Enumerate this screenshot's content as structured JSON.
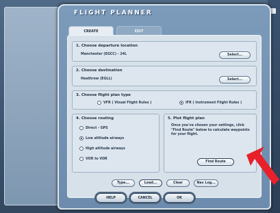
{
  "window": {
    "title": "FLIGHT PLANNER"
  },
  "tabs": [
    {
      "label": "CREATE"
    },
    {
      "label": "EDIT"
    }
  ],
  "section1": {
    "title": "1. Choose departure location",
    "value": "Manchester (EGCC) - 24L",
    "button": "Select..."
  },
  "section2": {
    "title": "2. Choose destination",
    "value": "Heathrow (EGLL)",
    "button": "Select..."
  },
  "section3": {
    "title": "3. Choose flight plan type",
    "options": [
      {
        "label": "VFR  ( Visual Flight Rules )",
        "selected": false
      },
      {
        "label": "IFR  ( Instrument Flight Rules )",
        "selected": true
      }
    ]
  },
  "section4": {
    "title": "4. Choose routing",
    "options": [
      {
        "label": "Direct - GPS",
        "selected": false
      },
      {
        "label": "Low altitude airways",
        "selected": true
      },
      {
        "label": "High altitude airways",
        "selected": false
      },
      {
        "label": "VOR to VOR",
        "selected": false
      }
    ]
  },
  "section5": {
    "title": "5. Plot flight plan",
    "text": "Once you've chosen your settings, click \"Find Route\" below to calculate waypoints for your flight.",
    "button": "Find Route"
  },
  "actions": {
    "type": "Type...",
    "load": "Load...",
    "clear": "Clear",
    "navlog": "Nav Log..."
  },
  "footer": {
    "help": "HELP",
    "cancel": "CANCEL",
    "ok": "OK"
  },
  "colors": {
    "annotation_arrow": "#e8202a"
  }
}
